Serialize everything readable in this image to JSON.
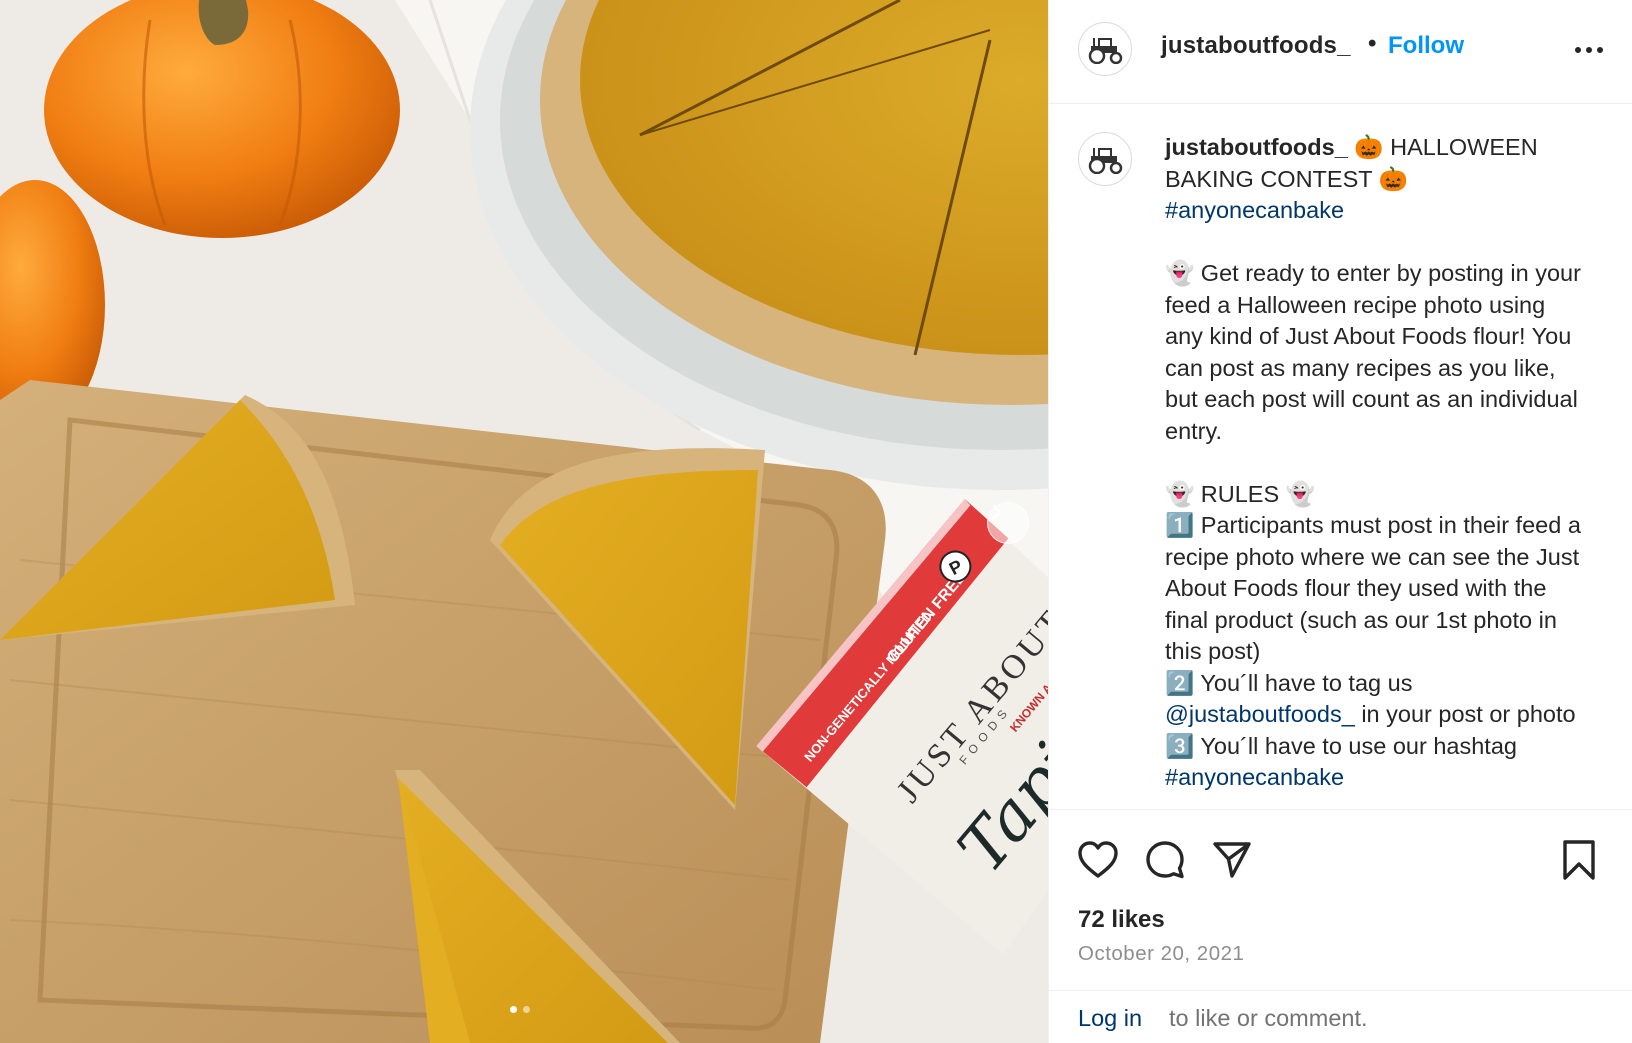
{
  "post": {
    "username": "justaboutfoods_",
    "separator": "•",
    "follow_label": "Follow",
    "more_icon": "more-horizontal-icon",
    "avatar_icon": "tractor-logo-icon"
  },
  "caption": {
    "username": "justaboutfoods_",
    "title_line": " 🎃 HALLOWEEN BAKING CONTEST 🎃",
    "hashtag": "#anyonecanbake",
    "para1": "👻 Get ready to enter by posting in your feed a Halloween recipe photo using any kind of Just About Foods flour! You can post as many recipes as you like, but each post will count as an individual entry.",
    "rules_heading": "👻 RULES 👻",
    "rule1": "1️⃣ Participants must post in their feed a recipe photo where we can see the Just About Foods flour they used with the final product (such as our 1st photo in this post)",
    "rule2_prefix": "2️⃣ You´ll have to tag us",
    "rule2_mention": "@justaboutfoods_",
    "rule2_suffix": " in your post or photo",
    "rule3": "3️⃣ You´ll have to use our hashtag",
    "rule3_hashtag": "#anyonecanbake"
  },
  "actions": {
    "like_icon": "heart-icon",
    "comment_icon": "comment-icon",
    "share_icon": "send-icon",
    "save_icon": "bookmark-icon"
  },
  "stats": {
    "likes": "72 likes",
    "date": "October 20, 2021"
  },
  "login": {
    "link": "Log in",
    "text": "to like or comment."
  },
  "media": {
    "next_icon": "chevron-right-icon",
    "carousel_dots": 2,
    "active_dot": 0,
    "package_text": {
      "brand": "JUST ABOUT",
      "brand_sub": "FOODS",
      "product": "Tapioca",
      "badge": "GLUTEN FREE",
      "badge2": "NON-GENETICALLY MODIFIED",
      "subtitle": "KNOWN AS TAPIOCA STARCH"
    }
  },
  "colors": {
    "link_blue": "#0095f6",
    "hashtag_blue": "#00376b",
    "pie_filling": "#d9a21b",
    "crust": "#d8b680",
    "board": "#c9a46d"
  }
}
